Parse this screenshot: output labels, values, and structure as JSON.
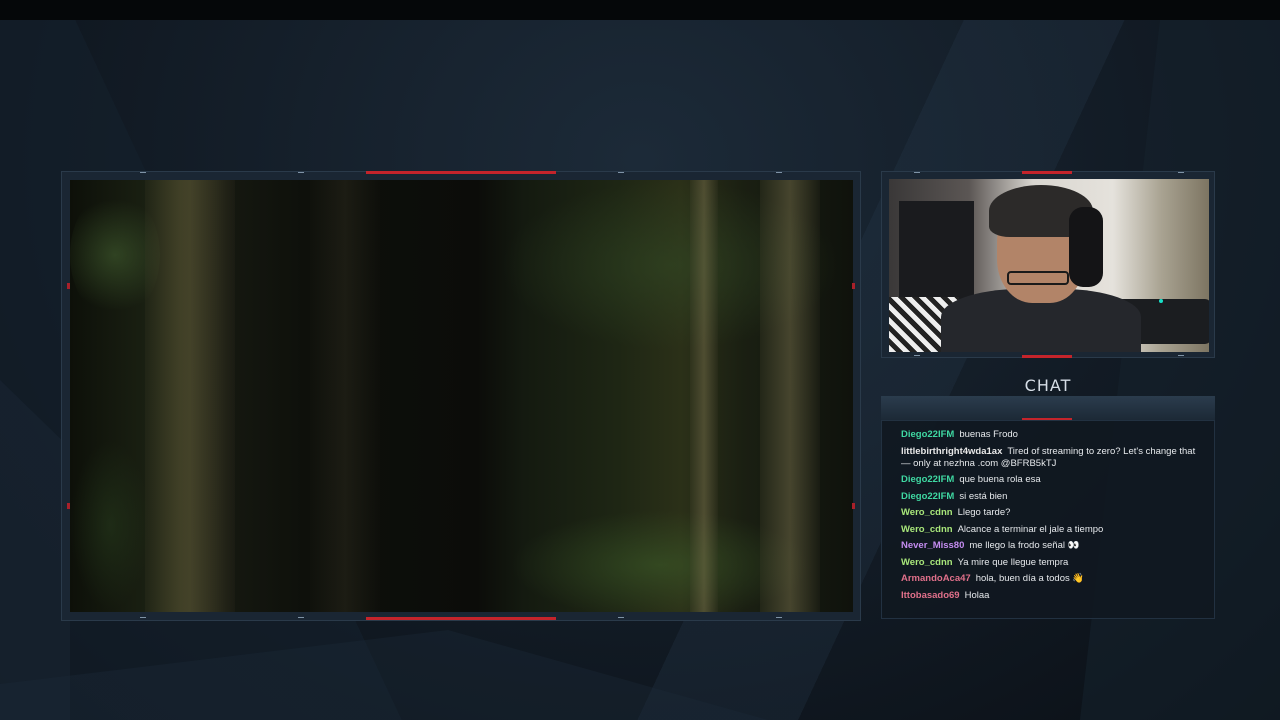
{
  "chat": {
    "title": "CHAT",
    "messages": [
      {
        "user": "Diego22IFM",
        "color": "#3fd8a2",
        "text": "buenas Frodo"
      },
      {
        "user": "littlebirthright4wda1ax",
        "color": "#e8e8e8",
        "text": "Tired of streaming to zero? Let's change that — only at nezhna .com @BFRB5kTJ"
      },
      {
        "user": "Diego22IFM",
        "color": "#3fd8a2",
        "text": "que buena rola esa"
      },
      {
        "user": "Diego22IFM",
        "color": "#3fd8a2",
        "text": "si está bien"
      },
      {
        "user": "Wero_cdnn",
        "color": "#a8e67a",
        "text": "Llego tarde?"
      },
      {
        "user": "Wero_cdnn",
        "color": "#a8e67a",
        "text": "Alcance a terminar el jale a tiempo"
      },
      {
        "user": "Never_Miss80",
        "color": "#c48cf0",
        "text": "me llego la frodo señal 👀"
      },
      {
        "user": "Wero_cdnn",
        "color": "#a8e67a",
        "text": "Ya mire que llegue tempra"
      },
      {
        "user": "ArmandoAca47",
        "color": "#e0708a",
        "text": "hola, buen día a todos 👋"
      },
      {
        "user": "Ittobasado69",
        "color": "#e0708a",
        "text": "Holaa"
      }
    ]
  },
  "colors": {
    "accent": "#c4242b",
    "frame": "#1a2633"
  }
}
